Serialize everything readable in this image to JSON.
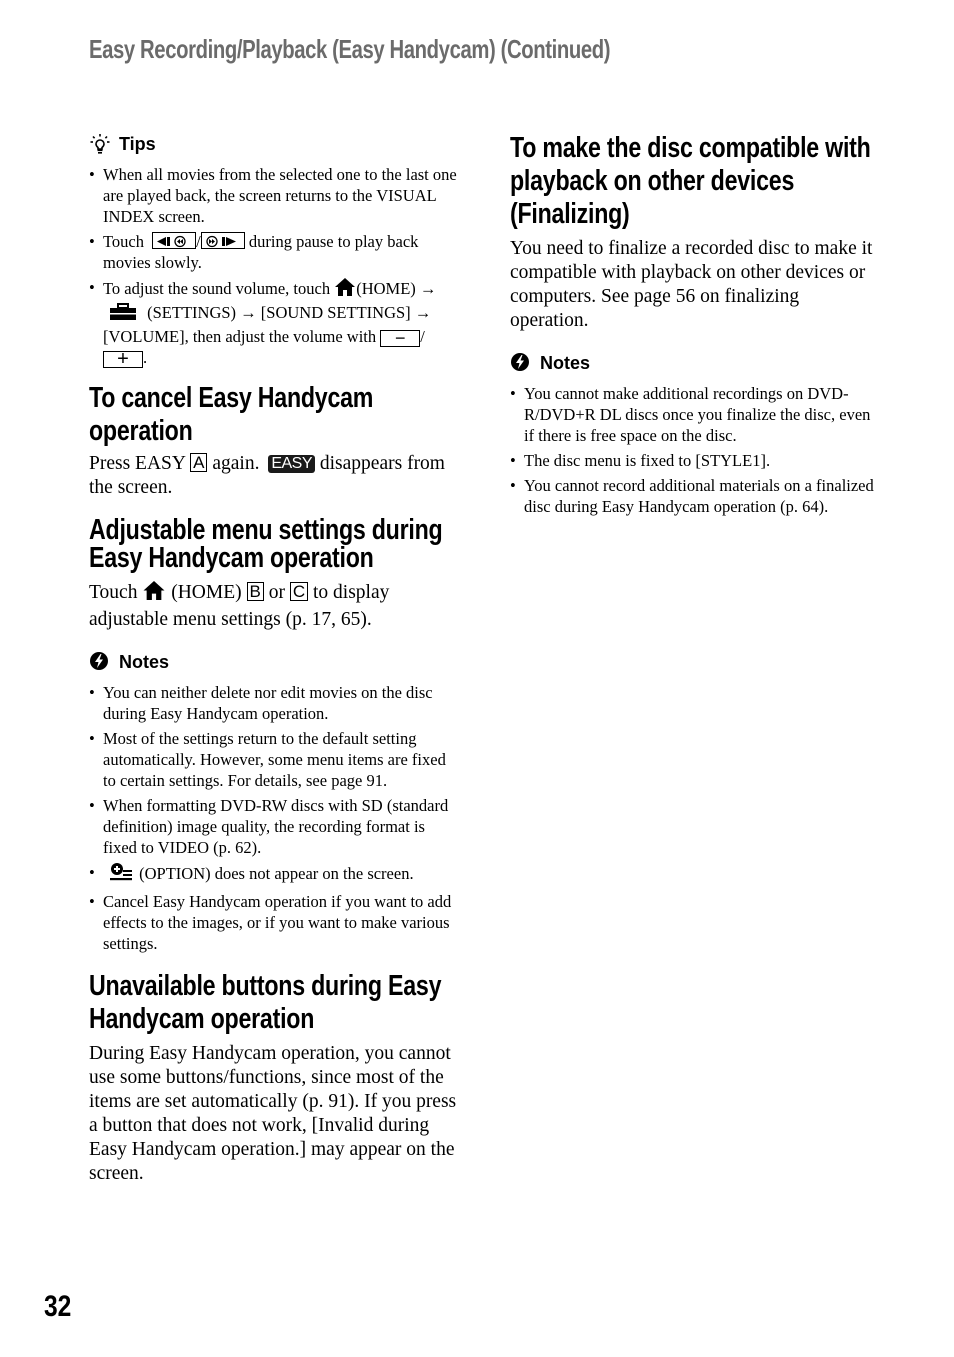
{
  "header": {
    "title": "Easy Recording/Playback (Easy Handycam) (Continued)"
  },
  "left_column": {
    "tips": {
      "label": "Tips",
      "icon": "lightbulb-icon",
      "items": [
        {
          "text": "When all movies from the selected one to the last one are played back, the screen returns to the VISUAL INDEX screen."
        },
        {
          "pre": "Touch",
          "sep": "/",
          "post": "during pause to play back movies slowly.",
          "buttons": [
            "slow-reverse-button",
            "slow-forward-button"
          ]
        },
        {
          "pre": "To adjust the sound volume, touch",
          "home": "(HOME)",
          "arrow": "→",
          "settings": "(SETTINGS)",
          "mid": "[SOUND SETTINGS]",
          "mid2": "[VOLUME], then adjust the volume with",
          "minus": "−",
          "sep": "/",
          "plus": "+",
          "end": "."
        }
      ]
    },
    "cancel_section": {
      "title": "To cancel Easy Handycam operation",
      "pre": "Press EASY",
      "key": "A",
      "mid": "again.",
      "badge": "EASY",
      "post": "disappears from the screen."
    },
    "adjustable_section": {
      "title": "Adjustable menu settings during Easy Handycam operation",
      "pre": "Touch",
      "home": "(HOME)",
      "key_b": "B",
      "or": "or",
      "key_c": "C",
      "post": "to display adjustable menu settings (p. 17, 65)."
    },
    "notes": {
      "label": "Notes",
      "icon": "notes-icon",
      "items": [
        {
          "text": "You can neither delete nor edit movies on the disc during Easy Handycam operation."
        },
        {
          "text": "Most of the settings return to the default setting automatically. However, some menu items are fixed to certain settings. For details, see page 91."
        },
        {
          "text": "When formatting DVD-RW discs with SD (standard definition) image quality, the recording format is fixed to VIDEO (p. 62)."
        },
        {
          "text": "(OPTION) does not appear on the screen.",
          "icon": "option-icon"
        },
        {
          "text": "Cancel Easy Handycam operation if you want to add effects to the images, or if you want to make various settings."
        }
      ]
    },
    "unavailable_section": {
      "title": "Unavailable buttons during Easy Handycam operation",
      "body": "During Easy Handycam operation, you cannot use some buttons/functions, since most of the items are set automatically (p. 91). If you press a button that does not work, [Invalid during Easy Handycam operation.] may appear on the screen."
    }
  },
  "right_column": {
    "finalize_section": {
      "title": "To make the disc compatible with playback on other devices (Finalizing)",
      "body": "You need to finalize a recorded disc to make it compatible with playback on other devices or computers. See page 56 on finalizing operation."
    },
    "notes": {
      "label": "Notes",
      "icon": "notes-icon",
      "items": [
        {
          "text": "You cannot make additional recordings on DVD-R/DVD+R DL discs once you finalize the disc, even if there is free space on the disc."
        },
        {
          "text": "The disc menu is fixed to [STYLE1]."
        },
        {
          "text": "You cannot record additional materials on a finalized disc during Easy Handycam operation (p. 64)."
        }
      ]
    }
  },
  "footer": {
    "page_number": "32"
  },
  "colors": {
    "header_gray": "#6b6b6b",
    "text": "#000000",
    "background": "#ffffff"
  }
}
